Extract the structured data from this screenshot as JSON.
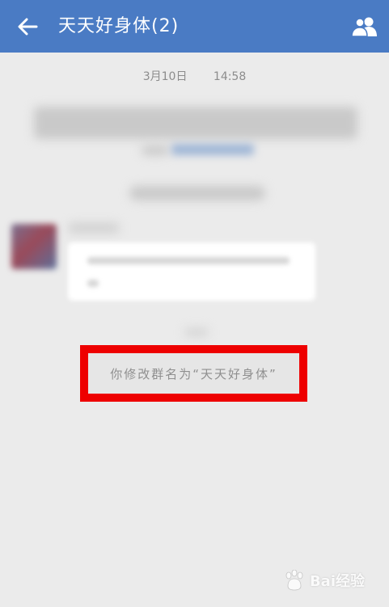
{
  "header": {
    "title": "天天好身体(2)",
    "back_icon": "arrow-left-icon",
    "members_icon": "group-members-icon",
    "bar_color": "#4a7bc4"
  },
  "chat": {
    "timestamp": "3月10日 14:58",
    "system_message": "你修改群名为“天天好身体”"
  },
  "annotation": {
    "highlight_color": "#ee0000"
  },
  "watermark": {
    "text": "Bai经验"
  }
}
